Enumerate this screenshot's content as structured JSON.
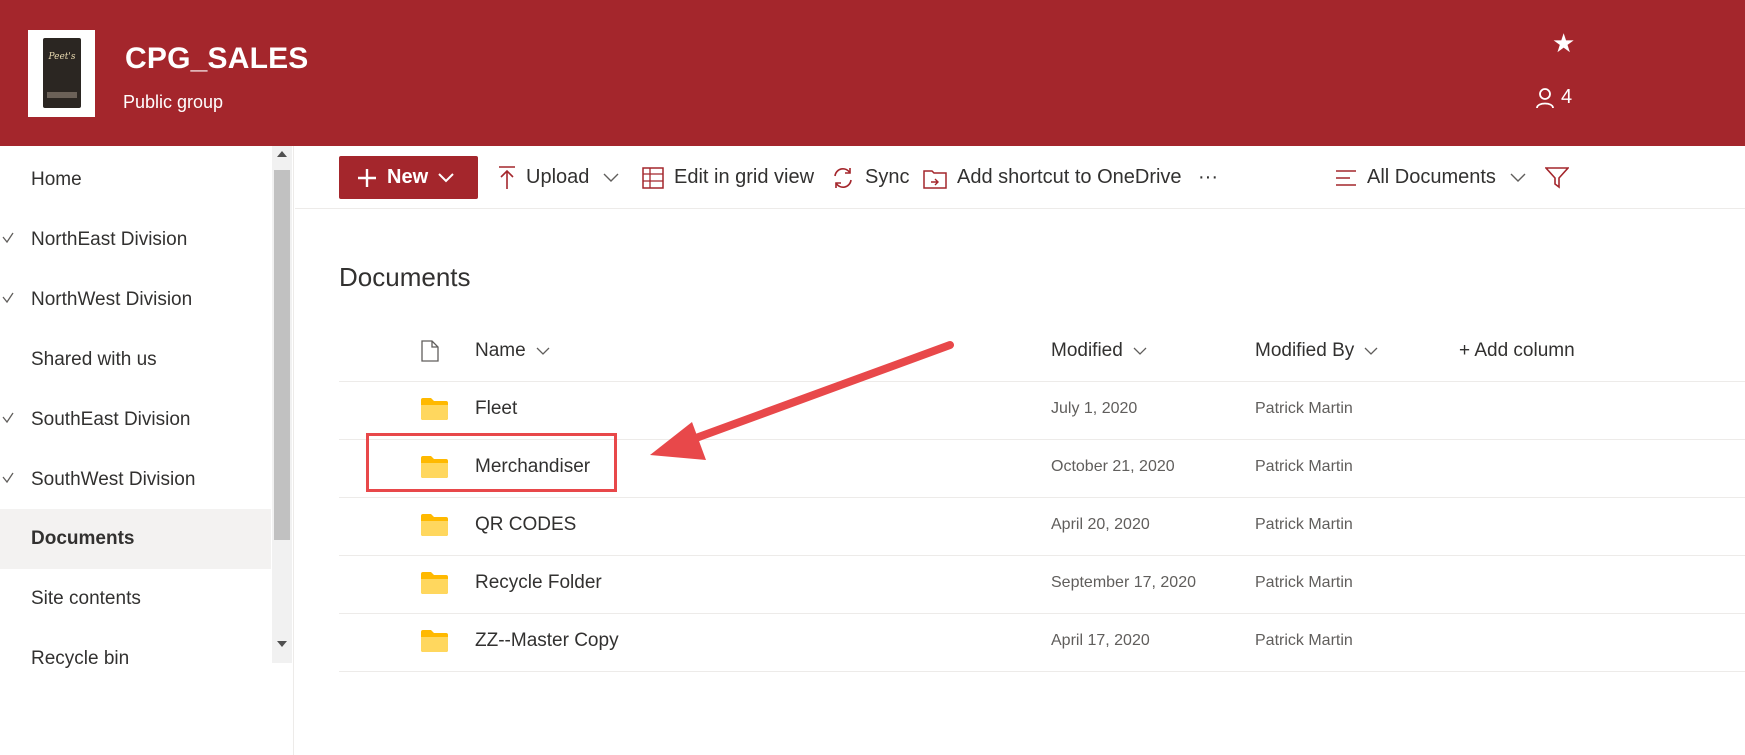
{
  "header": {
    "site_title": "CPG_SALES",
    "site_subtitle": "Public group",
    "brand_color": "#a4262c",
    "logo_text": "Peet's",
    "follow_icon": "star-icon",
    "members_icon": "person-icon",
    "members_count": "4"
  },
  "leftnav": {
    "items": [
      {
        "label": "Home",
        "checked": false
      },
      {
        "label": "NorthEast Division",
        "checked": true
      },
      {
        "label": "NorthWest Division",
        "checked": true
      },
      {
        "label": "Shared with us",
        "checked": false
      },
      {
        "label": "SouthEast Division",
        "checked": true
      },
      {
        "label": "SouthWest Division",
        "checked": true
      },
      {
        "label": "Documents",
        "checked": false,
        "selected": true
      },
      {
        "label": "Site contents",
        "checked": false
      },
      {
        "label": "Recycle bin",
        "checked": false
      }
    ]
  },
  "commandbar": {
    "new_label": "New",
    "upload_label": "Upload",
    "grid_label": "Edit in grid view",
    "sync_label": "Sync",
    "shortcut_label": "Add shortcut to OneDrive",
    "more_label": "···",
    "view_label": "All Documents"
  },
  "main": {
    "heading": "Documents",
    "columns": {
      "name": "Name",
      "modified": "Modified",
      "modified_by": "Modified By",
      "add_column": "+ Add column"
    },
    "rows": [
      {
        "name": "Fleet",
        "modified": "July 1, 2020",
        "modified_by": "Patrick Martin"
      },
      {
        "name": "Merchandiser",
        "modified": "October 21, 2020",
        "modified_by": "Patrick Martin"
      },
      {
        "name": "QR CODES",
        "modified": "April 20, 2020",
        "modified_by": "Patrick Martin"
      },
      {
        "name": "Recycle Folder",
        "modified": "September 17, 2020",
        "modified_by": "Patrick Martin"
      },
      {
        "name": "ZZ--Master Copy",
        "modified": "April 17, 2020",
        "modified_by": "Patrick Martin"
      }
    ],
    "annotation_color": "#e8484a",
    "folder_color": "#ffb900"
  }
}
